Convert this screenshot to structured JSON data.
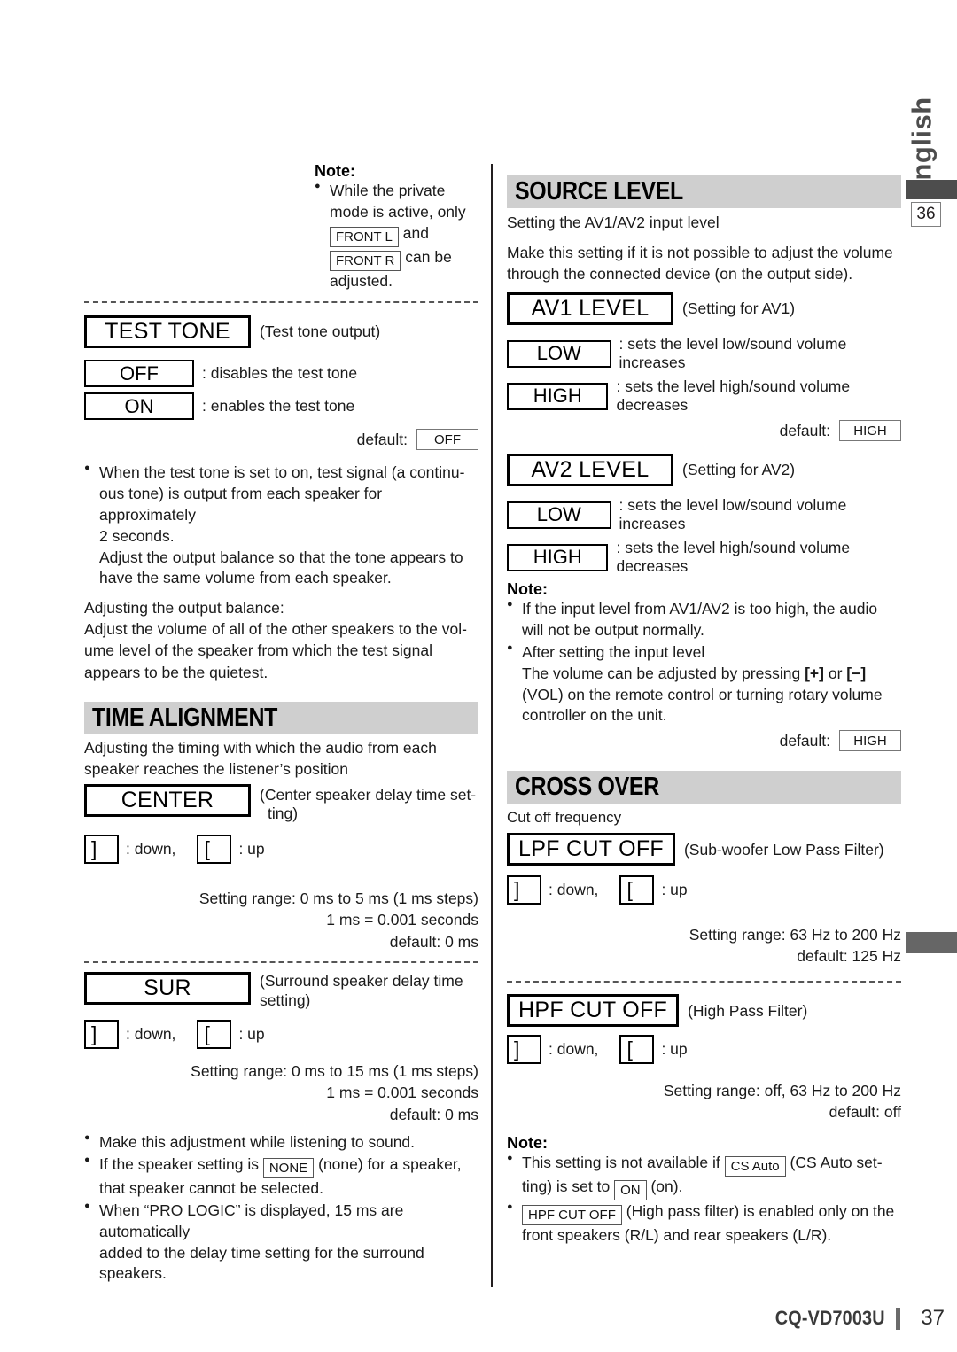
{
  "sidebar": {
    "language_tab": "English",
    "page_marker": "36"
  },
  "footer": {
    "model": "CQ-VD7003U",
    "page": "37"
  },
  "left_column": {
    "top_note": {
      "title": "Note:",
      "bullet_prefix": "While the private",
      "line2": "mode is active, only",
      "box_front_l": "FRONT L",
      "and_text": "and",
      "box_front_r": "FRONT R",
      "can_be_text": "can be",
      "line_last": "adjusted."
    },
    "test_tone": {
      "label": "TEST TONE",
      "caption": "(Test tone output)",
      "options": [
        {
          "box": "OFF",
          "desc": ": disables the test tone"
        },
        {
          "box": "ON",
          "desc": ": enables the test tone"
        }
      ],
      "default_label": "default:",
      "default_value": "OFF",
      "notes": [
        "When the test tone is set to on,  test signal (a continu-ous tone) is output from each speaker for approximately 2 seconds.",
        "Adjust the output balance so that the tone appears to have the same volume from each speaker."
      ],
      "note_line1": "When the test tone is set to on,  test signal (a continu-",
      "note_line2": "ous tone) is output from each speaker for approximately",
      "note_line3": "2 seconds.",
      "note_line4": "Adjust the output balance so that the tone appears to",
      "note_line5": "have the same volume from each speaker.",
      "balance_heading": "Adjusting the output balance:",
      "balance_line1": "Adjust the volume of all of the other speakers to the vol-",
      "balance_line2": "ume level of the speaker from which the test signal",
      "balance_line3": "appears to be the quietest."
    },
    "time_alignment": {
      "heading": "TIME ALIGNMENT",
      "intro_line1": "Adjusting the timing with which the audio from each",
      "intro_line2": "speaker reaches the listener’s position",
      "center": {
        "label": "CENTER",
        "caption_line1": "(Center speaker delay time set-",
        "caption_line2": "ting)",
        "down_glyph": "]",
        "down_text": ": down,",
        "up_glyph": "[",
        "up_text": ": up",
        "range": "Setting range: 0 ms to 5 ms (1 ms steps)",
        "conversion": "1 ms = 0.001 seconds",
        "default": "default: 0 ms"
      },
      "sur": {
        "label": "SUR",
        "caption_line1": "(Surround speaker delay time",
        "caption_line2": "setting)",
        "down_glyph": "]",
        "down_text": ": down,",
        "up_glyph": "[",
        "up_text": ": up",
        "range": "Setting range: 0 ms to 15 ms (1 ms steps)",
        "conversion": "1 ms = 0.001 seconds",
        "default": "default: 0 ms"
      },
      "notes": {
        "n1": "Make this adjustment while listening to sound.",
        "n2_pre": "If the speaker setting is",
        "n2_box": "NONE",
        "n2_post": "(none) for a speaker,",
        "n2_line2": "that speaker cannot be selected.",
        "n3_line1": "When “PRO LOGIC” is displayed, 15 ms are automatically",
        "n3_line2": "added to the delay time setting for the surround speakers."
      }
    }
  },
  "right_column": {
    "source_level": {
      "heading": "SOURCE LEVEL",
      "intro": "Setting the AV1/AV2 input level",
      "desc_line1": "Make this setting if it is not possible to adjust the volume",
      "desc_line2": "through the connected device (on the output side).",
      "av1": {
        "label": "AV1 LEVEL",
        "caption": "(Setting for AV1)",
        "low_box": "LOW",
        "low_desc": ": sets the level low/sound volume increases",
        "high_box": "HIGH",
        "high_desc": ": sets the level high/sound volume decreases",
        "default_label": "default:",
        "default_value": "HIGH"
      },
      "av2": {
        "label": "AV2 LEVEL",
        "caption": "(Setting for AV2)",
        "low_box": "LOW",
        "low_desc": ": sets the level low/sound volume increases",
        "high_box": "HIGH",
        "high_desc": ": sets the level high/sound volume decreases",
        "default_label": "default:",
        "default_value": "HIGH"
      },
      "note": {
        "title": "Note:",
        "n1_line1": "If the input level from AV1/AV2 is too high, the audio",
        "n1_line2": "will not be output normally.",
        "n2_line1": "After setting the input level",
        "n2_line2_pre": "The volume can be adjusted by pressing",
        "n2_plus": "[+]",
        "n2_or": "or",
        "n2_minus": "[−]",
        "n2_line3": "(VOL) on the remote control or turning rotary volume",
        "n2_line4": "controller on the unit."
      }
    },
    "cross_over": {
      "heading": "CROSS OVER",
      "intro": "Cut off frequency",
      "lpf": {
        "label": "LPF CUT OFF",
        "caption": "(Sub-woofer Low Pass Filter)",
        "down_glyph": "]",
        "down_text": ": down,",
        "up_glyph": "[",
        "up_text": ": up",
        "range": "Setting range: 63 Hz to 200 Hz",
        "default": "default: 125 Hz"
      },
      "hpf": {
        "label": "HPF CUT OFF",
        "caption": "(High Pass Filter)",
        "down_glyph": "]",
        "down_text": ": down,",
        "up_glyph": "[",
        "up_text": ": up",
        "range": "Setting range: off, 63 Hz to 200 Hz",
        "default": "default: off"
      },
      "note": {
        "title": "Note:",
        "n1_pre": "This setting is not available if",
        "n1_box": "CS Auto",
        "n1_mid": "(CS Auto set-",
        "n1_line2_pre": "ting) is set to",
        "n1_box2": "ON",
        "n1_line2_post": "(on).",
        "n2_box": "HPF CUT OFF",
        "n2_post": "(High pass filter) is enabled only on the",
        "n2_line2": "front speakers (R/L) and rear speakers (L/R)."
      }
    }
  }
}
